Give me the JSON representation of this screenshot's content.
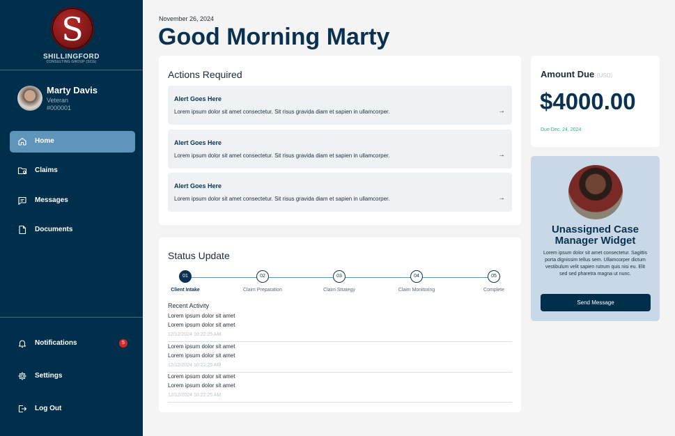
{
  "brand": {
    "logo_letter": "S",
    "name": "SHILLINGFORD",
    "subtitle": "CONSULTING GROUP (SCG)"
  },
  "profile": {
    "name": "Marty Davis",
    "role": "Veteran",
    "id": "#000001"
  },
  "nav": {
    "items": [
      {
        "label": "Home",
        "icon": "home-icon",
        "active": true
      },
      {
        "label": "Claims",
        "icon": "folder-icon",
        "active": false
      },
      {
        "label": "Messages",
        "icon": "chat-icon",
        "active": false
      },
      {
        "label": "Documents",
        "icon": "document-icon",
        "active": false
      }
    ],
    "bottom": [
      {
        "label": "Notifications",
        "icon": "bell-icon",
        "badge": "5"
      },
      {
        "label": "Settings",
        "icon": "gear-icon"
      },
      {
        "label": "Log Out",
        "icon": "logout-icon"
      }
    ]
  },
  "header": {
    "date": "November 26, 2024",
    "greeting": "Good Morning Marty"
  },
  "actions": {
    "title": "Actions Required",
    "alerts": [
      {
        "title": "Alert Goes Here",
        "body": "Lorem ipsum dolor sit amet consectetur. Sit risus gravida diam et sapien in ullamcorper.",
        "arrow": "→"
      },
      {
        "title": "Alert Goes Here",
        "body": "Lorem ipsum dolor sit amet consectetur. Sit risus gravida diam et sapien in ullamcorper.",
        "arrow": "→"
      },
      {
        "title": "Alert Goes Here",
        "body": "Lorem ipsum dolor sit amet consectetur. Sit risus gravida diam et sapien in ullamcorper.",
        "arrow": "→"
      }
    ]
  },
  "status": {
    "title": "Status Update",
    "steps": [
      {
        "num": "01",
        "label": "Client Intake",
        "done": true
      },
      {
        "num": "02",
        "label": "Claim Preparation",
        "done": false
      },
      {
        "num": "03",
        "label": "Claim Strategy",
        "done": false
      },
      {
        "num": "04",
        "label": "Claim Monitoring",
        "done": false
      },
      {
        "num": "05",
        "label": "Complete",
        "done": false
      }
    ],
    "recent_title": "Recent Activity",
    "activity": [
      {
        "line1": "Lorem ipsum dolor sit amet",
        "line2": "Lorem ipsum dolor sit amet",
        "time": "12/12/2024 10:22:25 AM"
      },
      {
        "line1": "Lorem ipsum dolor sit amet",
        "line2": "Lorem ipsum dolor sit amet",
        "time": "12/12/2024 10:22:25 AM"
      },
      {
        "line1": "Lorem ipsum dolor sit amet",
        "line2": "Lorem ipsum dolor sit amet",
        "time": "12/12/2024 10:22:25 AM"
      }
    ]
  },
  "amount": {
    "title": "Amount Due",
    "unit": "(USD)",
    "value": "$4000.00",
    "due": "Due Dec. 24, 2024"
  },
  "case_manager": {
    "title_line1": "Unassigned Case",
    "title_line2": "Manager Widget",
    "body": "Lorem ipsum dolor sit amet consectetur. Sagittis porta dignissim tellus sem. Ullamcorper dictum vestibulum velit sapien rutrum quis nisi eu. Elit sed sed pharetra magna ut nunc.",
    "button": "Send Message"
  },
  "colors": {
    "sidebar": "#002f4c",
    "active_nav": "#5f95bb",
    "accent_dark": "#0a3250",
    "due_green": "#22b58b",
    "badge_red": "#d02a2a",
    "widget_bg": "#c9d8e6"
  }
}
